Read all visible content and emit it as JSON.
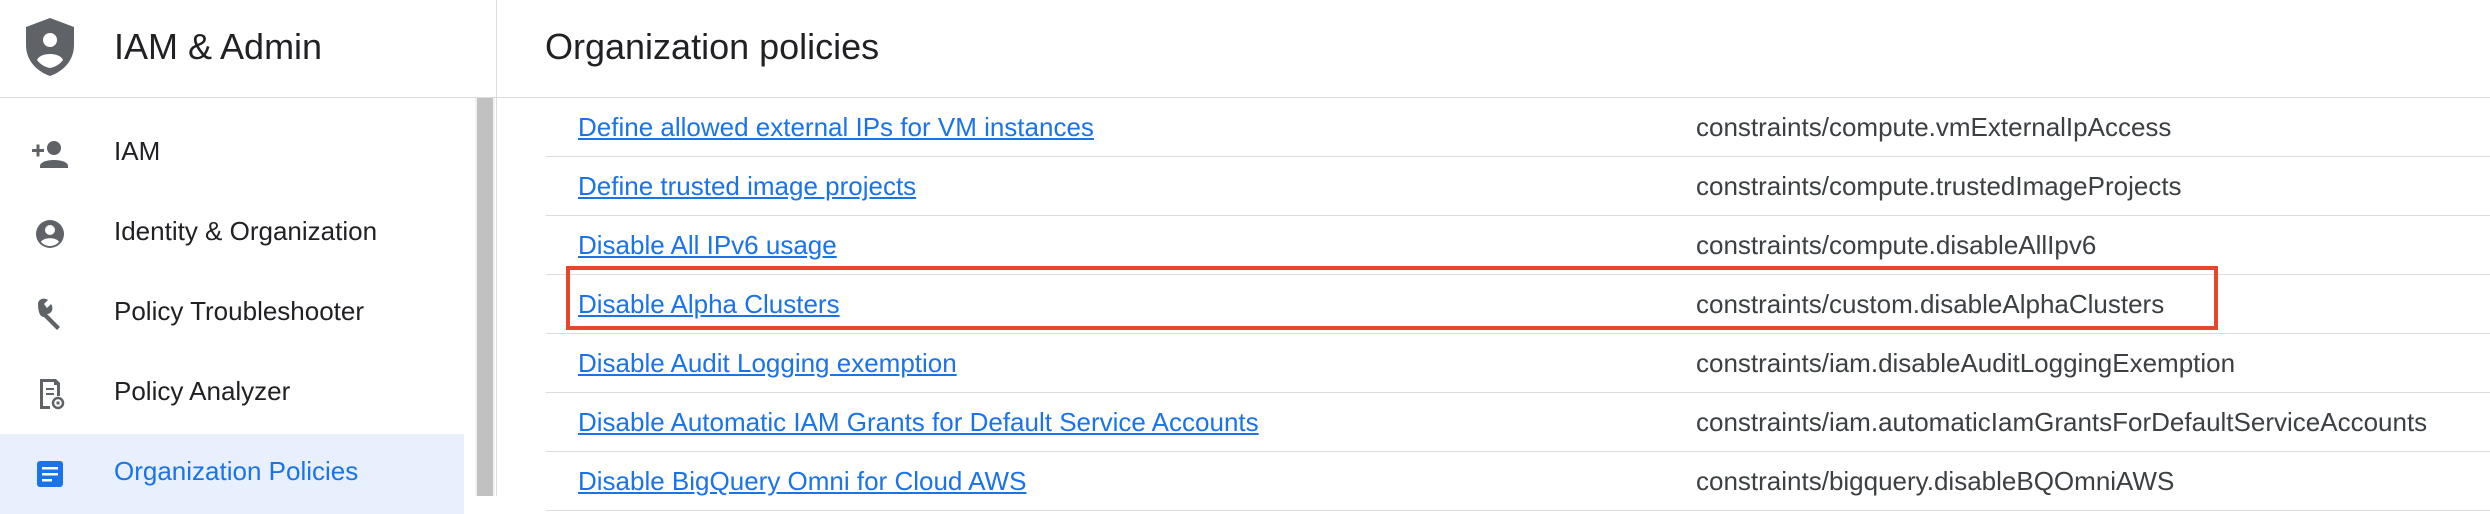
{
  "sidebar": {
    "title": "IAM & Admin",
    "items": [
      {
        "label": "IAM",
        "icon": "person-add-icon",
        "active": false
      },
      {
        "label": "Identity & Organization",
        "icon": "account-circle-icon",
        "active": false
      },
      {
        "label": "Policy Troubleshooter",
        "icon": "wrench-icon",
        "active": false
      },
      {
        "label": "Policy Analyzer",
        "icon": "policy-analyzer-icon",
        "active": false
      },
      {
        "label": "Organization Policies",
        "icon": "list-document-icon",
        "active": true
      }
    ]
  },
  "main": {
    "title": "Organization policies",
    "policies": [
      {
        "name": "Define allowed external IPs for VM instances",
        "constraint": "constraints/compute.vmExternalIpAccess"
      },
      {
        "name": "Define trusted image projects",
        "constraint": "constraints/compute.trustedImageProjects"
      },
      {
        "name": "Disable All IPv6 usage",
        "constraint": "constraints/compute.disableAllIpv6"
      },
      {
        "name": "Disable Alpha Clusters",
        "constraint": "constraints/custom.disableAlphaClusters"
      },
      {
        "name": "Disable Audit Logging exemption",
        "constraint": "constraints/iam.disableAuditLoggingExemption"
      },
      {
        "name": "Disable Automatic IAM Grants for Default Service Accounts",
        "constraint": "constraints/iam.automaticIamGrantsForDefaultServiceAccounts"
      },
      {
        "name": "Disable BigQuery Omni for Cloud AWS",
        "constraint": "constraints/bigquery.disableBQOmniAWS"
      }
    ]
  },
  "colors": {
    "link": "#1a73e8",
    "active_bg": "#e8f0fe",
    "highlight_border": "#e8452c",
    "icon": "#5f6368"
  }
}
